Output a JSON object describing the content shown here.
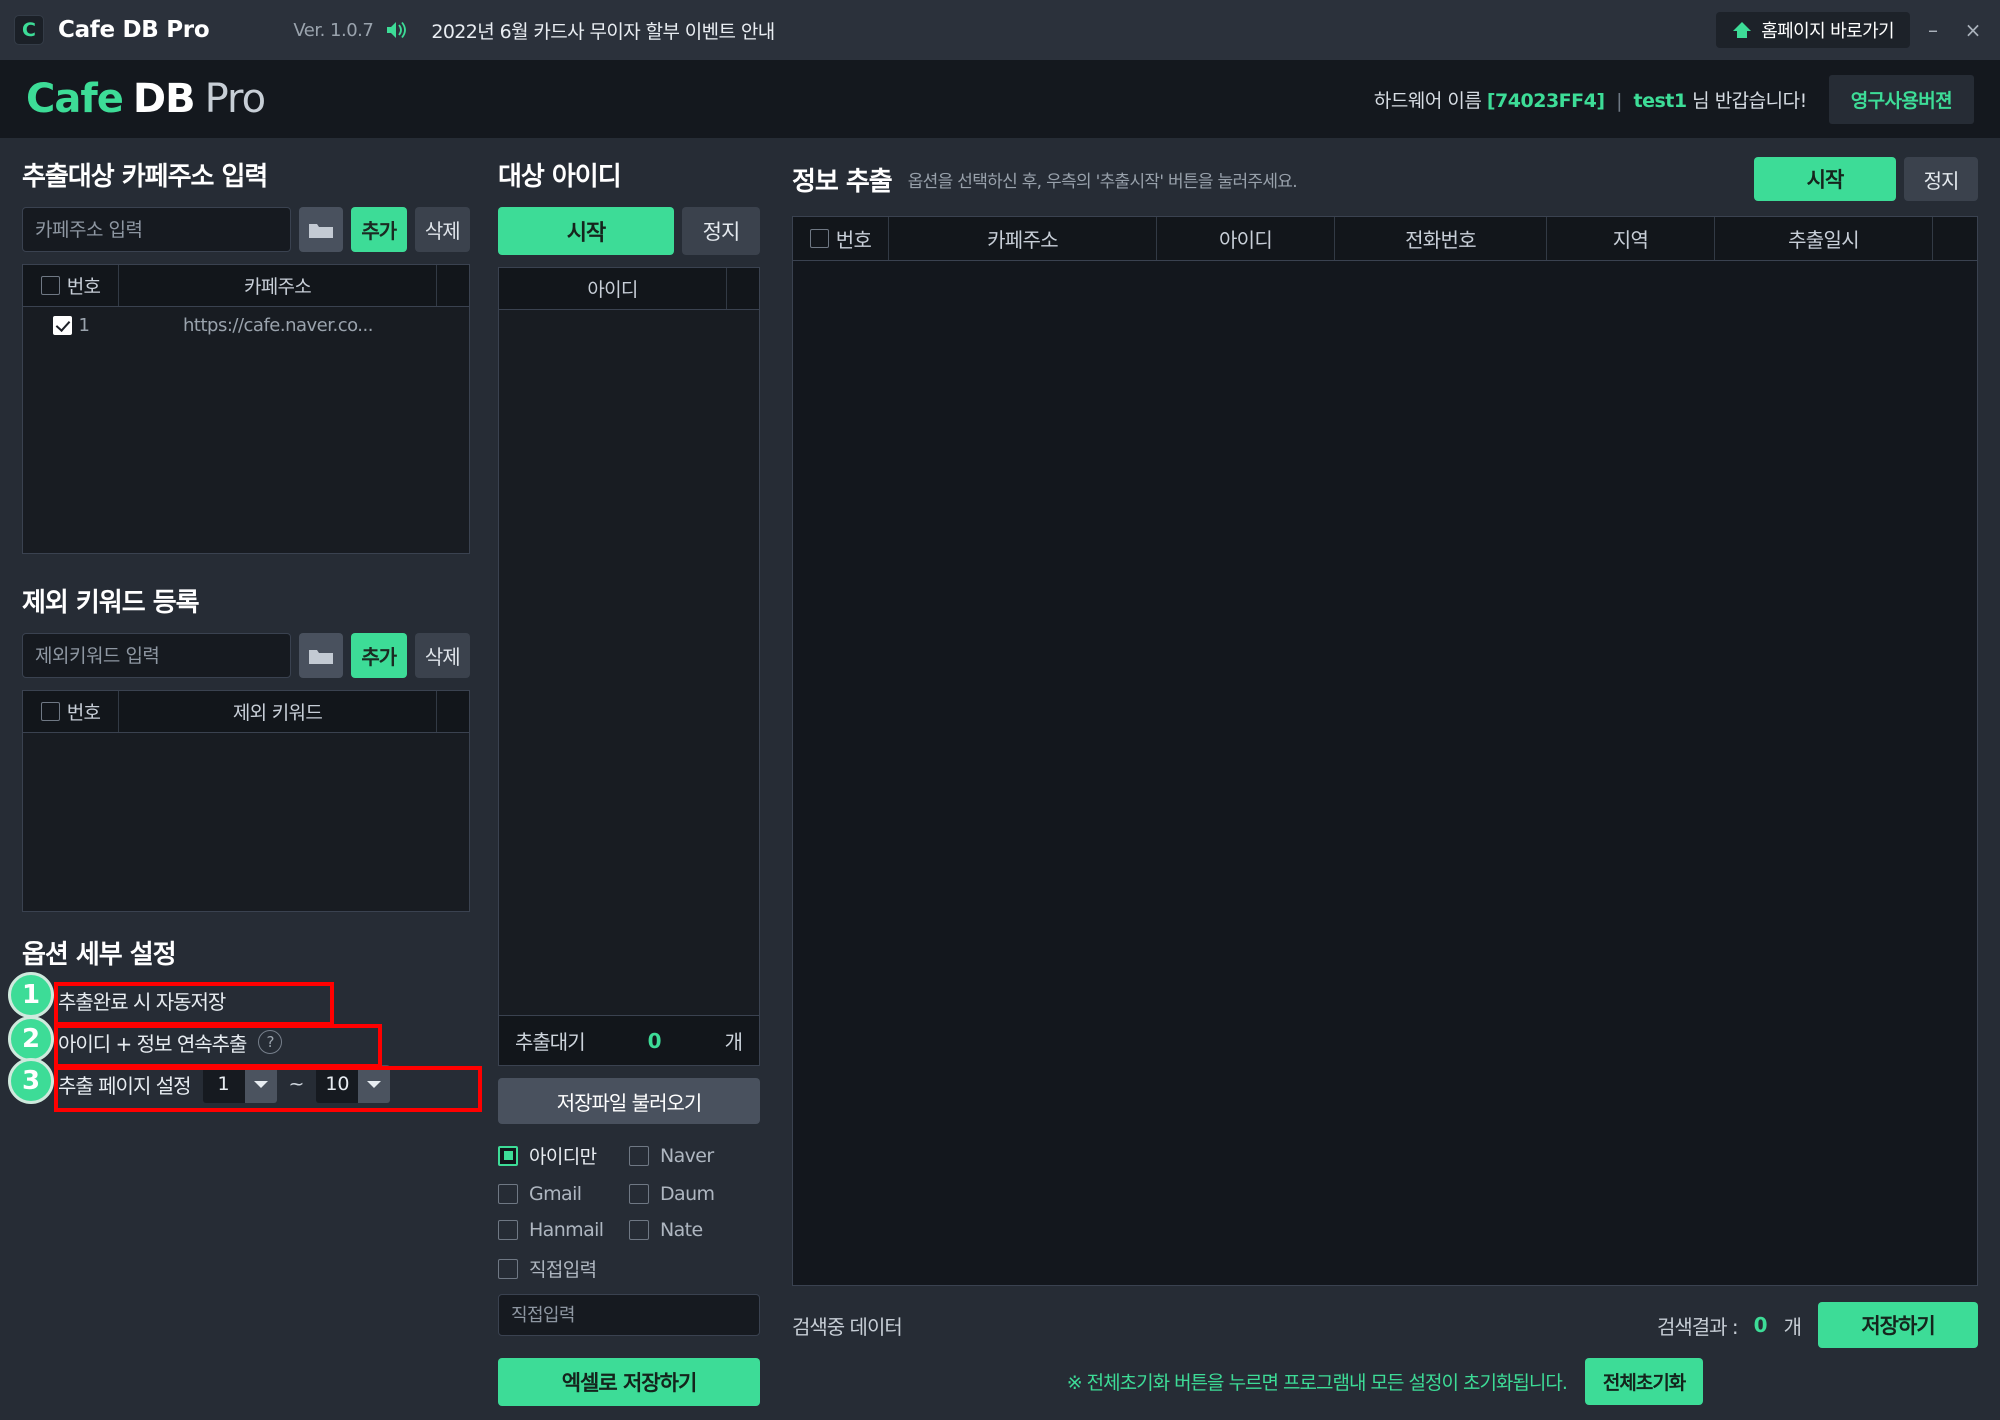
{
  "titlebar": {
    "logo_letter": "C",
    "app_title": "Cafe DB Pro",
    "version": "Ver. 1.0.7",
    "notice": "2022년 6월 카드사 무이자 할부 이벤트 안내",
    "home_button": "홈페이지 바로가기",
    "minimize": "–",
    "close": "×"
  },
  "brandbar": {
    "brand_1": "Cafe",
    "brand_2": "DB",
    "brand_3": "Pro",
    "hw_prefix": "하드웨어 이름",
    "hw_code": "[74023FF4]",
    "separator": "|",
    "user": "test1",
    "greeting": "님 반갑습니다!",
    "license_button": "영구사용버젼"
  },
  "cafe_panel": {
    "title": "추출대상 카페주소 입력",
    "input_placeholder": "카페주소 입력",
    "folder_icon": "folder-icon",
    "add_button": "추가",
    "delete_button": "삭제",
    "columns": [
      "번호",
      "카페주소"
    ],
    "rows": [
      {
        "checked": true,
        "no": "1",
        "address": "https://cafe.naver.co..."
      }
    ]
  },
  "keyword_panel": {
    "title": "제외 키워드 등록",
    "input_placeholder": "제외키워드 입력",
    "folder_icon": "folder-icon",
    "add_button": "추가",
    "delete_button": "삭제",
    "columns": [
      "번호",
      "제외 키워드"
    ],
    "rows": []
  },
  "options_panel": {
    "title": "옵션 세부 설정",
    "items": [
      {
        "badge": "1",
        "label": "추출완료 시 자동저장",
        "checked": true,
        "has_help": false
      },
      {
        "badge": "2",
        "label": "아이디 + 정보 연속추출",
        "checked": true,
        "has_help": true
      },
      {
        "badge": "3",
        "label": "추출 페이지 설정",
        "checked": true,
        "has_help": false
      }
    ],
    "page_from": "1",
    "page_to": "10",
    "page_tilde": "~"
  },
  "id_panel": {
    "title": "대상 아이디",
    "start_button": "시작",
    "stop_button": "정지",
    "columns": [
      "아이디"
    ],
    "rows": [],
    "waiting_label": "추출대기",
    "waiting_count": "0",
    "waiting_unit": "개",
    "load_button": "저장파일 불러오기",
    "checkboxes": [
      {
        "label": "아이디만",
        "type": "radio",
        "checked": true
      },
      {
        "label": "Naver",
        "type": "check",
        "checked": false
      },
      {
        "label": "Gmail",
        "type": "check",
        "checked": false
      },
      {
        "label": "Daum",
        "type": "check",
        "checked": false
      },
      {
        "label": "Hanmail",
        "type": "check",
        "checked": false
      },
      {
        "label": "Nate",
        "type": "check",
        "checked": false
      },
      {
        "label": "직접입력",
        "type": "check",
        "checked": false
      }
    ],
    "direct_placeholder": "직접입력",
    "excel_button": "엑셀로 저장하기"
  },
  "extract_panel": {
    "title": "정보 추출",
    "subtitle": "옵션을 선택하신 후, 우측의 '추출시작' 버튼을 눌러주세요.",
    "start_button": "시작",
    "stop_button": "정지",
    "columns": [
      "번호",
      "카페주소",
      "아이디",
      "전화번호",
      "지역",
      "추출일시"
    ],
    "rows": [],
    "status_text": "검색중 데이터",
    "result_label": "검색결과 :",
    "result_count": "0",
    "result_unit": "개",
    "save_button": "저장하기",
    "reset_note": "※ 전체초기화 버튼을 누르면 프로그램내 모든 설정이 초기화됩니다.",
    "reset_button": "전체초기화"
  },
  "colors": {
    "accent": "#3ddc97",
    "bg": "#262c35",
    "panel": "#14181e",
    "annotation": "#ff0000"
  }
}
